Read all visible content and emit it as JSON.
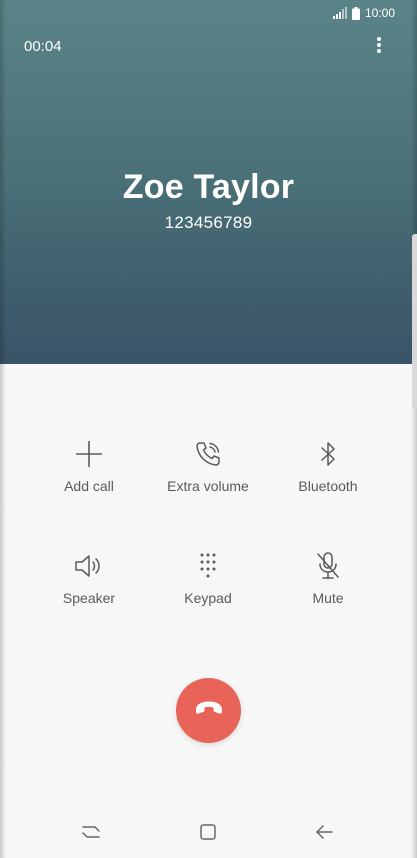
{
  "status_bar": {
    "time": "10:00"
  },
  "call": {
    "timer": "00:04",
    "contact_name": "Zoe Taylor",
    "contact_number": "123456789"
  },
  "actions": [
    {
      "label": "Add call",
      "icon": "plus-icon"
    },
    {
      "label": "Extra volume",
      "icon": "phone-volume-icon"
    },
    {
      "label": "Bluetooth",
      "icon": "bluetooth-icon"
    },
    {
      "label": "Speaker",
      "icon": "speaker-icon"
    },
    {
      "label": "Keypad",
      "icon": "keypad-icon"
    },
    {
      "label": "Mute",
      "icon": "microphone-off-icon"
    }
  ],
  "colors": {
    "header_top": "#5a8487",
    "header_bottom": "#3a5468",
    "end_call": "#e86358",
    "icon": "#5a5a5a"
  },
  "nav": {
    "recent": "recent-apps-icon",
    "home": "home-icon",
    "back": "back-icon"
  }
}
